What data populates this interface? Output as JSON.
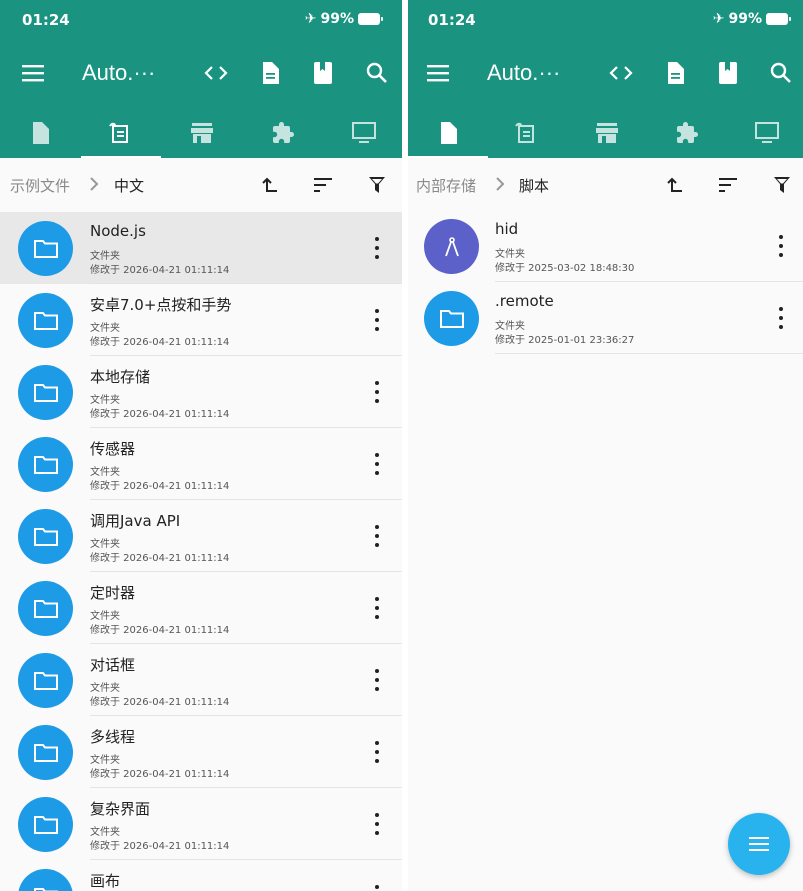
{
  "colors": {
    "appbar": "#1a9480",
    "folder": "#1e9be6",
    "script_icon": "#5b61c8",
    "fab": "#29b3ee"
  },
  "left": {
    "status": {
      "time": "01:24",
      "battery": "99%"
    },
    "title": "Auto.···",
    "toolbar_icons": [
      "menu-icon",
      "code-icon",
      "document-icon",
      "book-icon",
      "search-icon"
    ],
    "tabs": [
      "file-tab-icon",
      "script-tab-icon",
      "store-tab-icon",
      "extension-tab-icon",
      "monitor-tab-icon"
    ],
    "active_tab": 1,
    "breadcrumb": {
      "parent": "示例文件",
      "current": "中文"
    },
    "items": [
      {
        "name": "Node.js",
        "type": "文件夹",
        "modified": "修改于 2026-04-21 01:11:14",
        "selected": true
      },
      {
        "name": "安卓7.0+点按和手势",
        "type": "文件夹",
        "modified": "修改于 2026-04-21 01:11:14"
      },
      {
        "name": "本地存储",
        "type": "文件夹",
        "modified": "修改于 2026-04-21 01:11:14"
      },
      {
        "name": "传感器",
        "type": "文件夹",
        "modified": "修改于 2026-04-21 01:11:14"
      },
      {
        "name": "调用Java API",
        "type": "文件夹",
        "modified": "修改于 2026-04-21 01:11:14"
      },
      {
        "name": "定时器",
        "type": "文件夹",
        "modified": "修改于 2026-04-21 01:11:14"
      },
      {
        "name": "对话框",
        "type": "文件夹",
        "modified": "修改于 2026-04-21 01:11:14"
      },
      {
        "name": "多线程",
        "type": "文件夹",
        "modified": "修改于 2026-04-21 01:11:14"
      },
      {
        "name": "复杂界面",
        "type": "文件夹",
        "modified": "修改于 2026-04-21 01:11:14"
      },
      {
        "name": "画布",
        "type": "",
        "modified": ""
      }
    ]
  },
  "right": {
    "status": {
      "time": "01:24",
      "battery": "99%"
    },
    "title": "Auto.···",
    "active_tab": 0,
    "breadcrumb": {
      "parent": "内部存储",
      "current": "脚本"
    },
    "items": [
      {
        "name": "hid",
        "type": "文件夹",
        "modified": "修改于 2025-03-02 18:48:30",
        "icon": "compass-icon"
      },
      {
        "name": ".remote",
        "type": "文件夹",
        "modified": "修改于 2025-01-01 23:36:27",
        "icon": "folder-icon"
      }
    ]
  }
}
